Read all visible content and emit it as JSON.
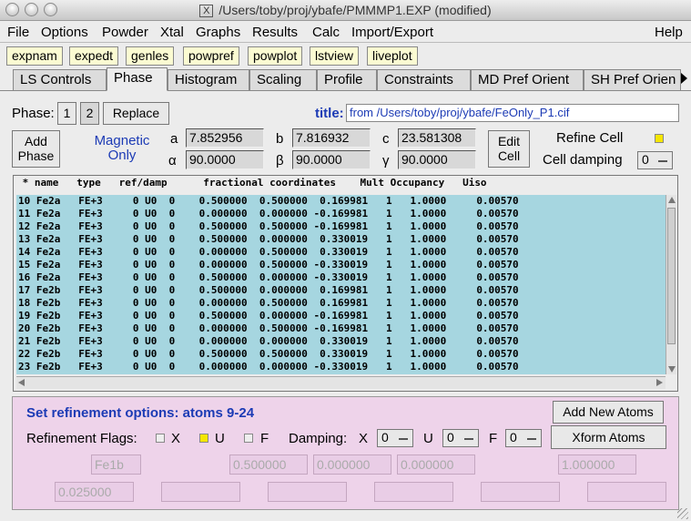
{
  "window": {
    "title": "/Users/toby/proj/ybafe/PMMMP1.EXP (modified)",
    "x_glyph": "X"
  },
  "menubar": {
    "items": [
      "File",
      "Options",
      "Powder",
      "Xtal",
      "Graphs",
      "Results",
      "Calc",
      "Import/Export"
    ],
    "help": "Help"
  },
  "shortcuts": [
    "expnam",
    "expedt",
    "genles",
    "powpref",
    "powplot",
    "lstview",
    "liveplot"
  ],
  "tabs": [
    "LS Controls",
    "Phase",
    "Histogram",
    "Scaling",
    "Profile",
    "Constraints",
    "MD Pref Orient",
    "SH Pref Orien"
  ],
  "selected_tab": "Phase",
  "phase": {
    "label": "Phase:",
    "buttons": [
      "1",
      "2"
    ],
    "selected": "2",
    "replace": "Replace",
    "title_label": "title:",
    "title_value": "from /Users/toby/proj/ybafe/FeOnly_P1.cif",
    "add_phase": [
      "Add",
      "Phase"
    ],
    "magnetic": [
      "Magnetic",
      "Only"
    ],
    "cell": {
      "a_label": "a",
      "a": "7.852956",
      "b_label": "b",
      "b": "7.816932",
      "c_label": "c",
      "c": "23.581308",
      "alpha_label": "α",
      "alpha": "90.0000",
      "beta_label": "β",
      "beta": "90.0000",
      "gamma_label": "γ",
      "gamma": "90.0000"
    },
    "edit_cell": [
      "Edit",
      "Cell"
    ],
    "refine_cell": "Refine Cell",
    "cell_damping": "Cell damping",
    "cell_damping_value": "0"
  },
  "atoms": {
    "header": " * name   type   ref/damp      fractional coordinates    Mult Occupancy   Uiso",
    "rows": [
      "10 Fe2a   FE+3     0 U0  0    0.500000  0.500000  0.169981   1   1.0000     0.00570",
      "11 Fe2a   FE+3     0 U0  0    0.000000  0.000000 -0.169981   1   1.0000     0.00570",
      "12 Fe2a   FE+3     0 U0  0    0.500000  0.500000 -0.169981   1   1.0000     0.00570",
      "13 Fe2a   FE+3     0 U0  0    0.500000  0.000000  0.330019   1   1.0000     0.00570",
      "14 Fe2a   FE+3     0 U0  0    0.000000  0.500000  0.330019   1   1.0000     0.00570",
      "15 Fe2a   FE+3     0 U0  0    0.000000  0.500000 -0.330019   1   1.0000     0.00570",
      "16 Fe2a   FE+3     0 U0  0    0.500000  0.000000 -0.330019   1   1.0000     0.00570",
      "17 Fe2b   FE+3     0 U0  0    0.500000  0.000000  0.169981   1   1.0000     0.00570",
      "18 Fe2b   FE+3     0 U0  0    0.000000  0.500000  0.169981   1   1.0000     0.00570",
      "19 Fe2b   FE+3     0 U0  0    0.500000  0.000000 -0.169981   1   1.0000     0.00570",
      "20 Fe2b   FE+3     0 U0  0    0.000000  0.500000 -0.169981   1   1.0000     0.00570",
      "21 Fe2b   FE+3     0 U0  0    0.000000  0.000000  0.330019   1   1.0000     0.00570",
      "22 Fe2b   FE+3     0 U0  0    0.500000  0.500000  0.330019   1   1.0000     0.00570",
      "23 Fe2b   FE+3     0 U0  0    0.000000  0.000000 -0.330019   1   1.0000     0.00570"
    ]
  },
  "refine": {
    "title": "Set refinement options: atoms 9-24",
    "flags_label": "Refinement Flags:",
    "flag_x": "X",
    "flag_u": "U",
    "flag_f": "F",
    "damping_label": "Damping:",
    "damp_x_label": "X",
    "damp_x": "0",
    "damp_u_label": "U",
    "damp_u": "0",
    "damp_f_label": "F",
    "damp_f": "0",
    "add_new_atoms": "Add New Atoms",
    "xform_atoms": "Xform Atoms",
    "name_field": "Fe1b",
    "x_field": "0.500000",
    "y_field": "0.000000",
    "z_field": "0.000000",
    "occ_field": "1.000000",
    "uiso_field": "0.025000"
  },
  "colors": {
    "table_bg": "#a6d6e0",
    "refine_bg": "#eed3ea",
    "accent_blue": "#1c3bb5",
    "checkbox_on": "#f5e600",
    "shortcut_bg": "#fbfbd2"
  }
}
